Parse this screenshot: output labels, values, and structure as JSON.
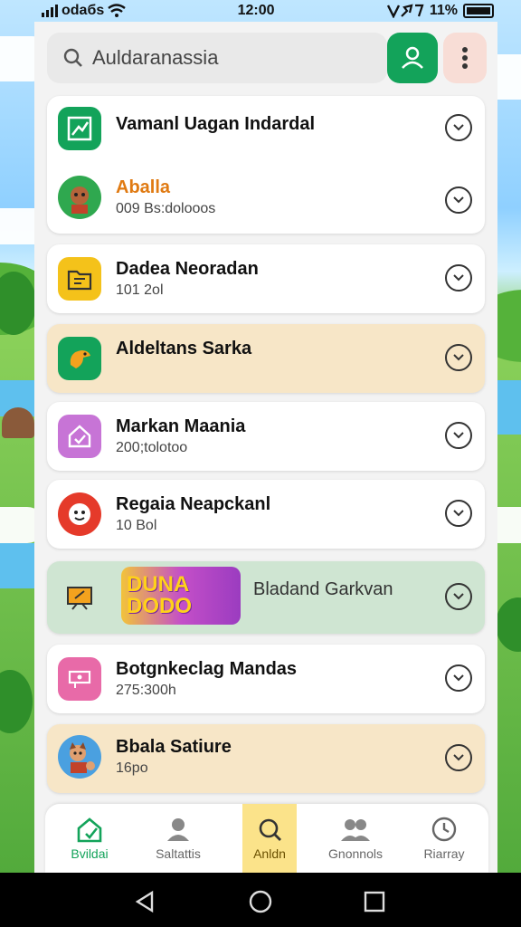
{
  "status_bar": {
    "carrier": "odaбs",
    "time": "12:00",
    "battery": "11%"
  },
  "search": {
    "placeholder": "Auldaranassia"
  },
  "list": [
    {
      "title": "Vamanl Uagan Indardal",
      "subtitle": "",
      "icon": "chart-icon",
      "icon_bg": "#13a35a",
      "highlight": "#ffffff"
    },
    {
      "title": "Aballa",
      "subtitle": "009 Bs:dolooos",
      "icon": "avatar-icon",
      "icon_bg": "#2fa84f",
      "highlight": "#ffffff",
      "title_color": "#e07a12"
    },
    {
      "title": "Dadea Neoradan",
      "subtitle": "101 2ol",
      "icon": "folder-icon",
      "icon_bg": "#f4c21a",
      "highlight": "#ffffff"
    },
    {
      "title": "Aldeltans Sarka",
      "subtitle": "",
      "icon": "bird-icon",
      "icon_bg": "#13a35a",
      "highlight": "#f7e6c7"
    },
    {
      "title": "Markan Maania",
      "subtitle": "200;tolotoo",
      "icon": "house-icon",
      "icon_bg": "#c774d6",
      "highlight": "#ffffff"
    },
    {
      "title": "Regaia Neapckanl",
      "subtitle": "10 Bol",
      "icon": "face-icon",
      "icon_bg": "#e53a2a",
      "highlight": "#ffffff"
    },
    {
      "title": "Bladand Garkvan",
      "subtitle": "",
      "icon": "easel-icon",
      "icon_bg": "#f3a21e",
      "highlight": "#cfe5d2",
      "banner": "DUNA DODO"
    },
    {
      "title": "Botgnkeclag Mandas",
      "subtitle": "275:300h",
      "icon": "ticket-icon",
      "icon_bg": "#e86aa8",
      "highlight": "#ffffff"
    },
    {
      "title": "Bbala Satiure",
      "subtitle": "16po",
      "icon": "kid-avatar-icon",
      "icon_bg": "#4aa0e0",
      "highlight": "#f7e6c7"
    }
  ],
  "bottom_nav": [
    {
      "label": "Bvildai",
      "icon": "home-icon"
    },
    {
      "label": "Saltattis",
      "icon": "person-icon"
    },
    {
      "label": "Anldn",
      "icon": "search-icon"
    },
    {
      "label": "Gnonnols",
      "icon": "group-icon"
    },
    {
      "label": "Riarray",
      "icon": "clock-icon"
    }
  ],
  "colors": {
    "accent": "#13a35a",
    "highlight_warm": "#f7e6c7",
    "highlight_green": "#cfe5d2",
    "nav_selected": "#fbe38a"
  }
}
